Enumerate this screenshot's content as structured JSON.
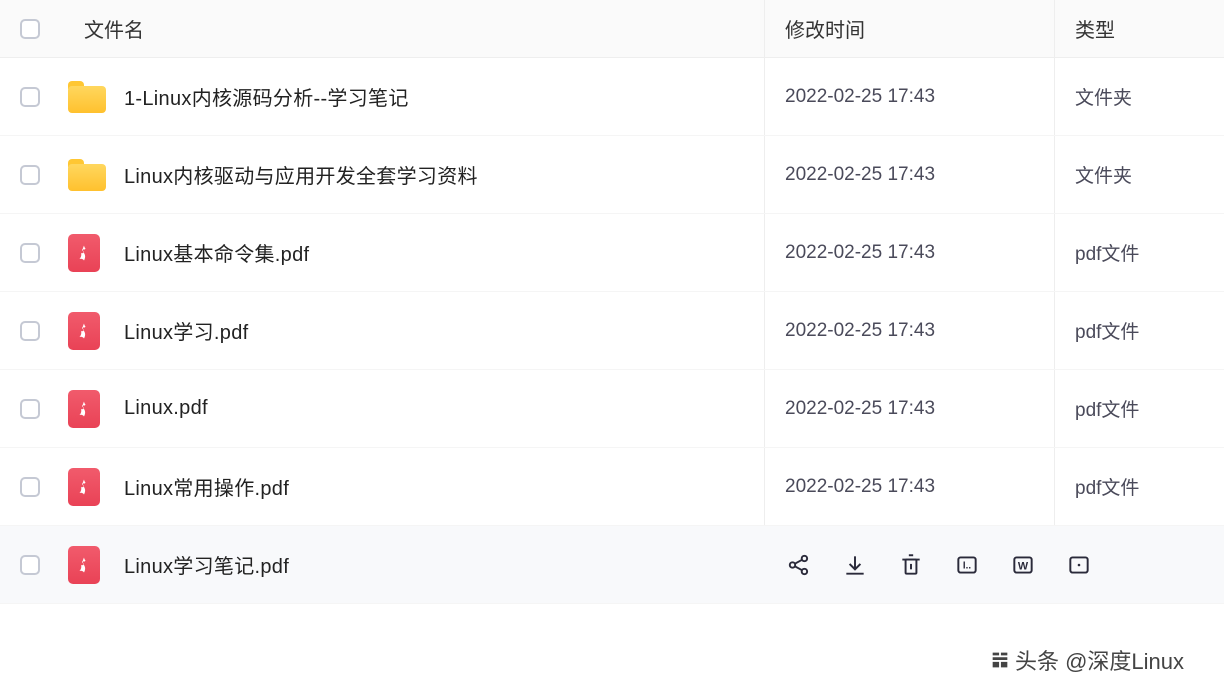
{
  "columns": {
    "name": "文件名",
    "time": "修改时间",
    "type": "类型"
  },
  "files": [
    {
      "icon": "folder",
      "name": "1-Linux内核源码分析--学习笔记",
      "time": "2022-02-25 17:43",
      "type": "文件夹",
      "hovered": false
    },
    {
      "icon": "folder",
      "name": "Linux内核驱动与应用开发全套学习资料",
      "time": "2022-02-25 17:43",
      "type": "文件夹",
      "hovered": false
    },
    {
      "icon": "pdf",
      "name": "Linux基本命令集.pdf",
      "time": "2022-02-25 17:43",
      "type": "pdf文件",
      "hovered": false
    },
    {
      "icon": "pdf",
      "name": "Linux学习.pdf",
      "time": "2022-02-25 17:43",
      "type": "pdf文件",
      "hovered": false
    },
    {
      "icon": "pdf",
      "name": "Linux.pdf",
      "time": "2022-02-25 17:43",
      "type": "pdf文件",
      "hovered": false
    },
    {
      "icon": "pdf",
      "name": "Linux常用操作.pdf",
      "time": "2022-02-25 17:43",
      "type": "pdf文件",
      "hovered": false
    },
    {
      "icon": "pdf",
      "name": "Linux学习笔记.pdf",
      "time": "",
      "type": "",
      "hovered": true
    }
  ],
  "watermark": "头条 @深度Linux"
}
